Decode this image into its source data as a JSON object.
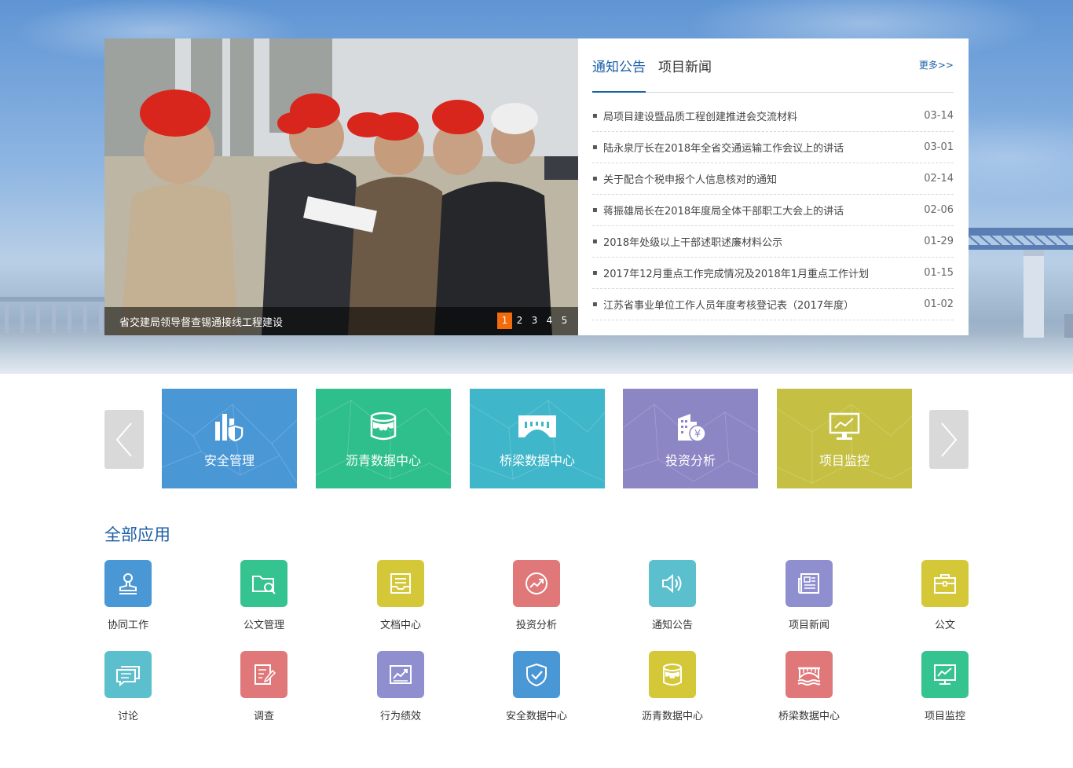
{
  "slider": {
    "caption": "省交建局领导督查锡通接线工程建设",
    "pages": [
      "1",
      "2",
      "3",
      "4",
      "5"
    ],
    "active_page": "1",
    "accent_color": "#f26c0b"
  },
  "news": {
    "tabs": [
      {
        "label": "通知公告",
        "active": true
      },
      {
        "label": "项目新闻",
        "active": false
      }
    ],
    "more_label": "更多>>",
    "bullet": "▪",
    "items": [
      {
        "title": "局项目建设暨品质工程创建推进会交流材料",
        "date": "03-14"
      },
      {
        "title": "陆永泉厅长在2018年全省交通运输工作会议上的讲话",
        "date": "03-01"
      },
      {
        "title": "关于配合个税申报个人信息核对的通知",
        "date": "02-14"
      },
      {
        "title": "蒋振雄局长在2018年度局全体干部职工大会上的讲话",
        "date": "02-06"
      },
      {
        "title": "2018年处级以上干部述职述廉材料公示",
        "date": "01-29"
      },
      {
        "title": "2017年12月重点工作完成情况及2018年1月重点工作计划",
        "date": "01-15"
      },
      {
        "title": "江苏省事业单位工作人员年度考核登记表（2017年度）",
        "date": "01-02"
      }
    ]
  },
  "carousel": {
    "tiles": [
      {
        "label": "安全管理",
        "color": "#4a97d6",
        "icon": "shield-chart-icon"
      },
      {
        "label": "沥青数据中心",
        "color": "#2fbf8c",
        "icon": "asphalt-bucket-icon"
      },
      {
        "label": "桥梁数据中心",
        "color": "#3fb6c9",
        "icon": "bridge-icon"
      },
      {
        "label": "投资分析",
        "color": "#8c86c4",
        "icon": "building-money-icon"
      },
      {
        "label": "项目监控",
        "color": "#c5c043",
        "icon": "monitor-chart-icon"
      }
    ]
  },
  "apps": {
    "title": "全部应用",
    "items": [
      {
        "label": "协同工作",
        "color": "#4a97d6",
        "icon": "stamp-icon"
      },
      {
        "label": "公文管理",
        "color": "#35c38f",
        "icon": "folder-search-icon"
      },
      {
        "label": "文档中心",
        "color": "#d4c838",
        "icon": "inbox-tray-icon"
      },
      {
        "label": "投资分析",
        "color": "#e0787a",
        "icon": "trend-circle-icon"
      },
      {
        "label": "通知公告",
        "color": "#5cbfce",
        "icon": "speaker-icon"
      },
      {
        "label": "项目新闻",
        "color": "#8f8fd0",
        "icon": "newspaper-icon"
      },
      {
        "label": "公文",
        "color": "#d4c838",
        "icon": "briefcase-icon"
      },
      {
        "label": "讨论",
        "color": "#5cbfce",
        "icon": "chat-icon"
      },
      {
        "label": "调查",
        "color": "#e0787a",
        "icon": "survey-edit-icon"
      },
      {
        "label": "行为绩效",
        "color": "#8f8fd0",
        "icon": "performance-chart-icon"
      },
      {
        "label": "安全数据中心",
        "color": "#4a97d6",
        "icon": "shield-check-icon"
      },
      {
        "label": "沥青数据中心",
        "color": "#d4c838",
        "icon": "asphalt-bucket-icon"
      },
      {
        "label": "桥梁数据中心",
        "color": "#e0787a",
        "icon": "bridge-water-icon"
      },
      {
        "label": "项目监控",
        "color": "#35c38f",
        "icon": "monitor-chart-icon"
      }
    ]
  }
}
